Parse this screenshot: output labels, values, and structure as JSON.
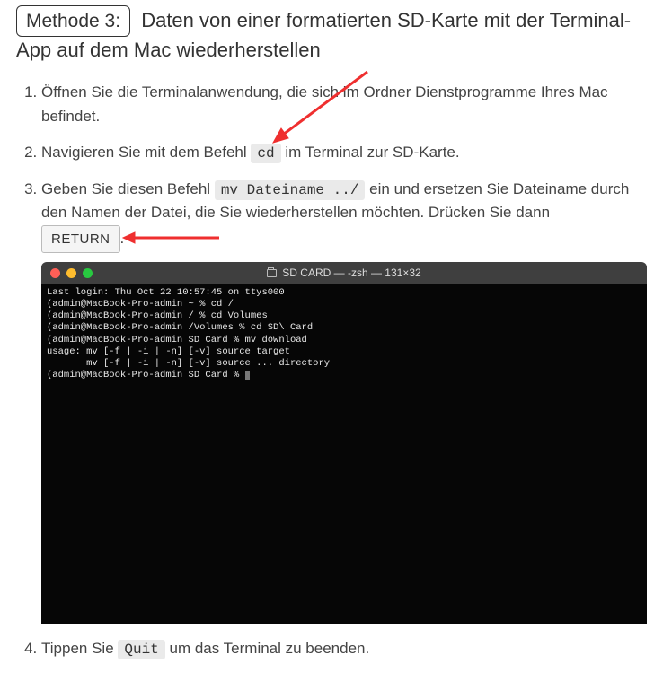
{
  "heading": {
    "tag": "Methode 3:",
    "rest": " Daten von einer formatierten SD-Karte mit der Terminal-App auf dem Mac wiederherstellen"
  },
  "steps": {
    "s1": "Öffnen Sie die Terminalanwendung, die sich im Ordner Dienstprogramme Ihres Mac befindet.",
    "s2a": "Navigieren Sie mit dem Befehl ",
    "s2code": "cd",
    "s2b": " im Terminal zur SD-Karte.",
    "s3a": "Geben Sie diesen Befehl ",
    "s3code": "mv Dateiname ../",
    "s3b": " ein und ersetzen Sie Dateiname durch den Namen der Datei, die Sie wiederherstellen möchten. Drücken Sie dann ",
    "s3btn": "RETURN",
    "s3dot": ".",
    "s4a": "Tippen Sie ",
    "s4code": "Quit",
    "s4b": " um das Terminal zu beenden."
  },
  "terminal": {
    "title": "SD CARD — -zsh — 131×32",
    "l1": "Last login: Thu Oct 22 10:57:45 on ttys000",
    "l2": "(admin@MacBook-Pro-admin ~ % cd /",
    "l3": "(admin@MacBook-Pro-admin / % cd Volumes",
    "l4": "(admin@MacBook-Pro-admin /Volumes % cd SD\\ Card",
    "l5": "(admin@MacBook-Pro-admin SD Card % mv download",
    "l6": "usage: mv [-f | -i | -n] [-v] source target",
    "l7": "       mv [-f | -i | -n] [-v] source ... directory",
    "l8": "(admin@MacBook-Pro-admin SD Card % "
  },
  "icons": {
    "folder": "folder-icon"
  }
}
